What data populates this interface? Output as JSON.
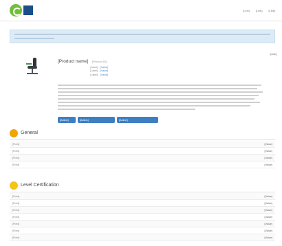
{
  "header": {
    "nav": [
      "[Link]",
      "[Link]",
      "[Link]"
    ]
  },
  "alert": {
    "text": "[Notice text]"
  },
  "product": {
    "title": "[Product name]",
    "subtitle": "[Product ID]",
    "badge": "[Link]",
    "meta": [
      {
        "key": "[Label]",
        "value": "[Value]"
      },
      {
        "key": "[Label]",
        "value": "[Value]"
      },
      {
        "key": "[Label]",
        "value": "[Value]"
      }
    ],
    "buttons": [
      "[Action]",
      "[Action]",
      "[Action]"
    ]
  },
  "general": {
    "title": "General",
    "rows": [
      {
        "key": "[Field]",
        "value": "[Value]"
      },
      {
        "key": "[Field]",
        "value": "[Value]"
      },
      {
        "key": "[Field]",
        "value": "[Value]"
      },
      {
        "key": "[Field]",
        "value": "[Value]"
      }
    ]
  },
  "certification": {
    "title": "Level Certification",
    "rows": [
      {
        "key": "[Field]",
        "value": "[Value]"
      },
      {
        "key": "[Field]",
        "value": "[Value]"
      },
      {
        "key": "[Field]",
        "value": "[Value]"
      },
      {
        "key": "[Field]",
        "value": "[Value]"
      },
      {
        "key": "[Field]",
        "value": "[Value]"
      },
      {
        "key": "[Field]",
        "value": "[Value]"
      },
      {
        "key": "[Field]",
        "value": "[Value]"
      }
    ]
  },
  "colors": {
    "accent": "#3e7fc4",
    "alert_bg": "#dcebf6",
    "logo_green": "#6fbf3b",
    "section_icon": "#f0a500"
  }
}
